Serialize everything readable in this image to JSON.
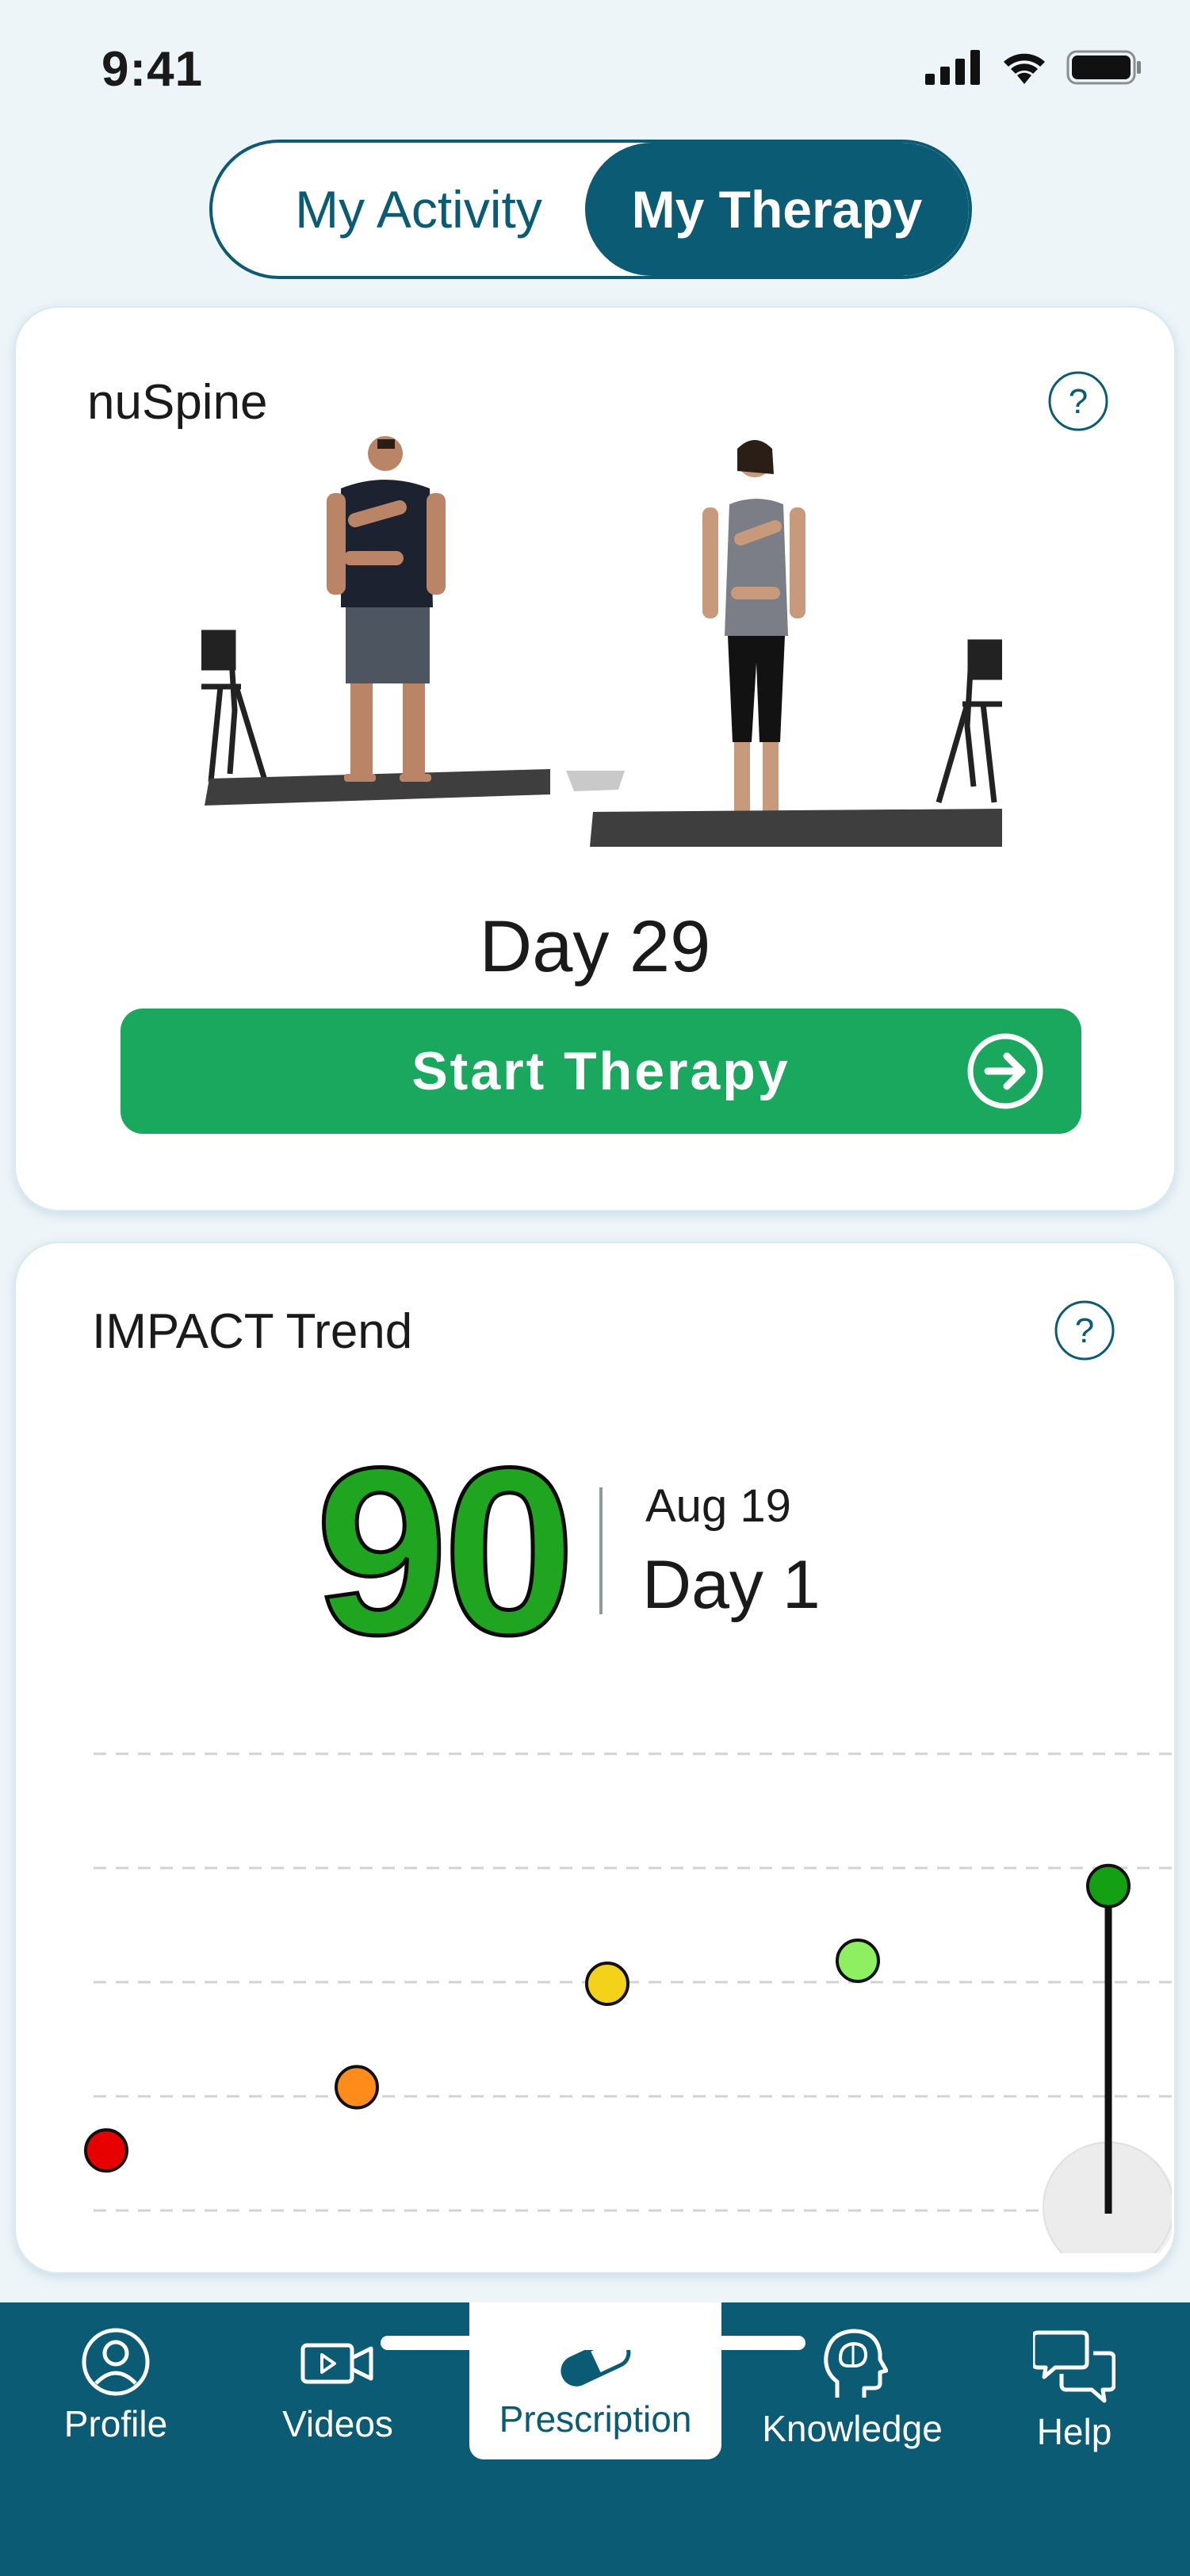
{
  "status_bar": {
    "time": "9:41"
  },
  "segmented": {
    "activity_label": "My Activity",
    "therapy_label": "My Therapy",
    "selected": "My Therapy"
  },
  "therapy_card": {
    "title": "nuSpine",
    "day_label": "Day 29",
    "start_button_label": "Start Therapy"
  },
  "impact_card": {
    "title": "IMPACT Trend",
    "score": "90",
    "date": "Aug 19",
    "day_label": "Day 1"
  },
  "chart_data": {
    "type": "scatter",
    "title": "",
    "xlabel": "",
    "ylabel": "",
    "grid": true,
    "points": [
      {
        "x": 1,
        "y": 11,
        "color": "#e60000"
      },
      {
        "x": 2,
        "y": 22,
        "color": "#ff8c1a"
      },
      {
        "x": 3,
        "y": 40,
        "color": "#f5d21a"
      },
      {
        "x": 4,
        "y": 44,
        "color": "#8ef060"
      },
      {
        "x": 5,
        "y": 57,
        "color": "#13a113",
        "selected": true
      }
    ],
    "xlim": [
      1,
      5
    ],
    "ylim": [
      0,
      80
    ]
  },
  "bottom_nav": {
    "items": [
      {
        "label": "Profile",
        "icon": "person-icon"
      },
      {
        "label": "Videos",
        "icon": "video-camera-icon"
      },
      {
        "label": "Prescription",
        "icon": "pill-icon",
        "selected": true
      },
      {
        "label": "Knowledge",
        "icon": "brain-head-icon"
      },
      {
        "label": "Help",
        "icon": "chat-bubbles-icon"
      }
    ]
  },
  "colors": {
    "primary": "#0b5b74",
    "start_button": "#19a85e",
    "score": "#1fa51f",
    "background": "#eef5f9"
  }
}
